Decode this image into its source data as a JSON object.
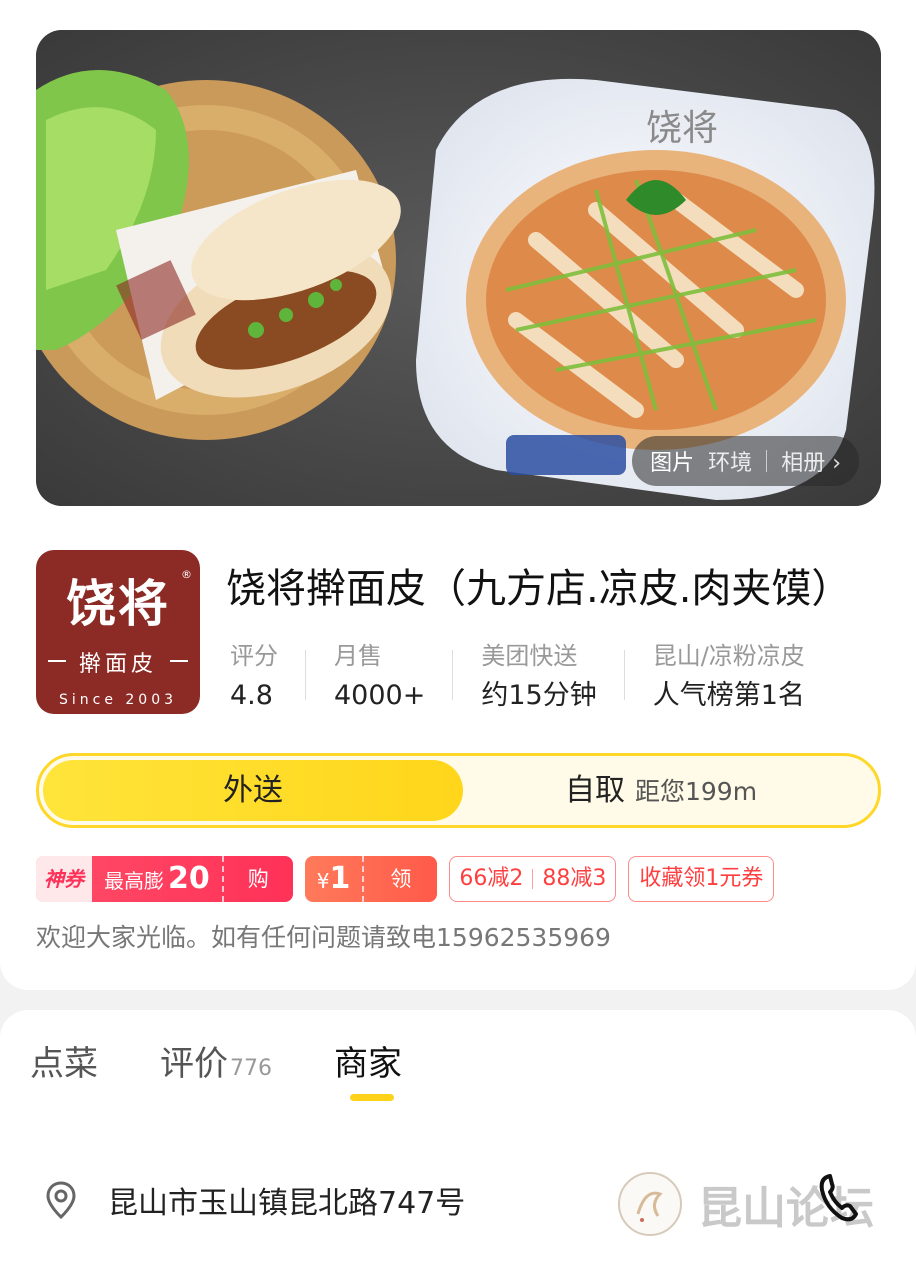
{
  "gallery": {
    "tab_photos": "图片",
    "tab_environment": "环境",
    "tab_album": "相册"
  },
  "logo": {
    "main": "饶将",
    "reg_mark": "®",
    "sub": "擀面皮",
    "since": "Since 2003"
  },
  "shop": {
    "name": "饶将擀面皮（九方店.凉皮.肉夹馍）"
  },
  "stats": [
    {
      "label": "评分",
      "value": "4.8"
    },
    {
      "label": "月售",
      "value": "4000+"
    },
    {
      "label": "美团快送",
      "value": "约15分钟"
    },
    {
      "label": "昆山/凉粉凉皮",
      "value": "人气榜第1名"
    }
  ],
  "delivery_toggle": {
    "delivery": "外送",
    "pickup": "自取",
    "distance": "距您199m"
  },
  "coupons": {
    "shenquan_tag": "神券",
    "shenquan_text": "最高膨",
    "shenquan_amount": "20",
    "shenquan_action": "购",
    "yuan_symbol": "¥",
    "yuan_amount": "1",
    "yuan_action": "领",
    "discount_1": "66减2",
    "discount_2": "88减3",
    "favorite_coupon": "收藏领1元券"
  },
  "notice": "欢迎大家光临。如有任何问题请致电15962535969",
  "tabs": [
    {
      "label": "点菜",
      "count": ""
    },
    {
      "label": "评价",
      "count": "776"
    },
    {
      "label": "商家",
      "count": ""
    }
  ],
  "address": "昆山市玉山镇昆北路747号",
  "watermark": "昆山论坛",
  "colors": {
    "accent_yellow": "#ffd61a",
    "coupon_red": "#ff3158",
    "logo_red": "#8c2a25"
  }
}
